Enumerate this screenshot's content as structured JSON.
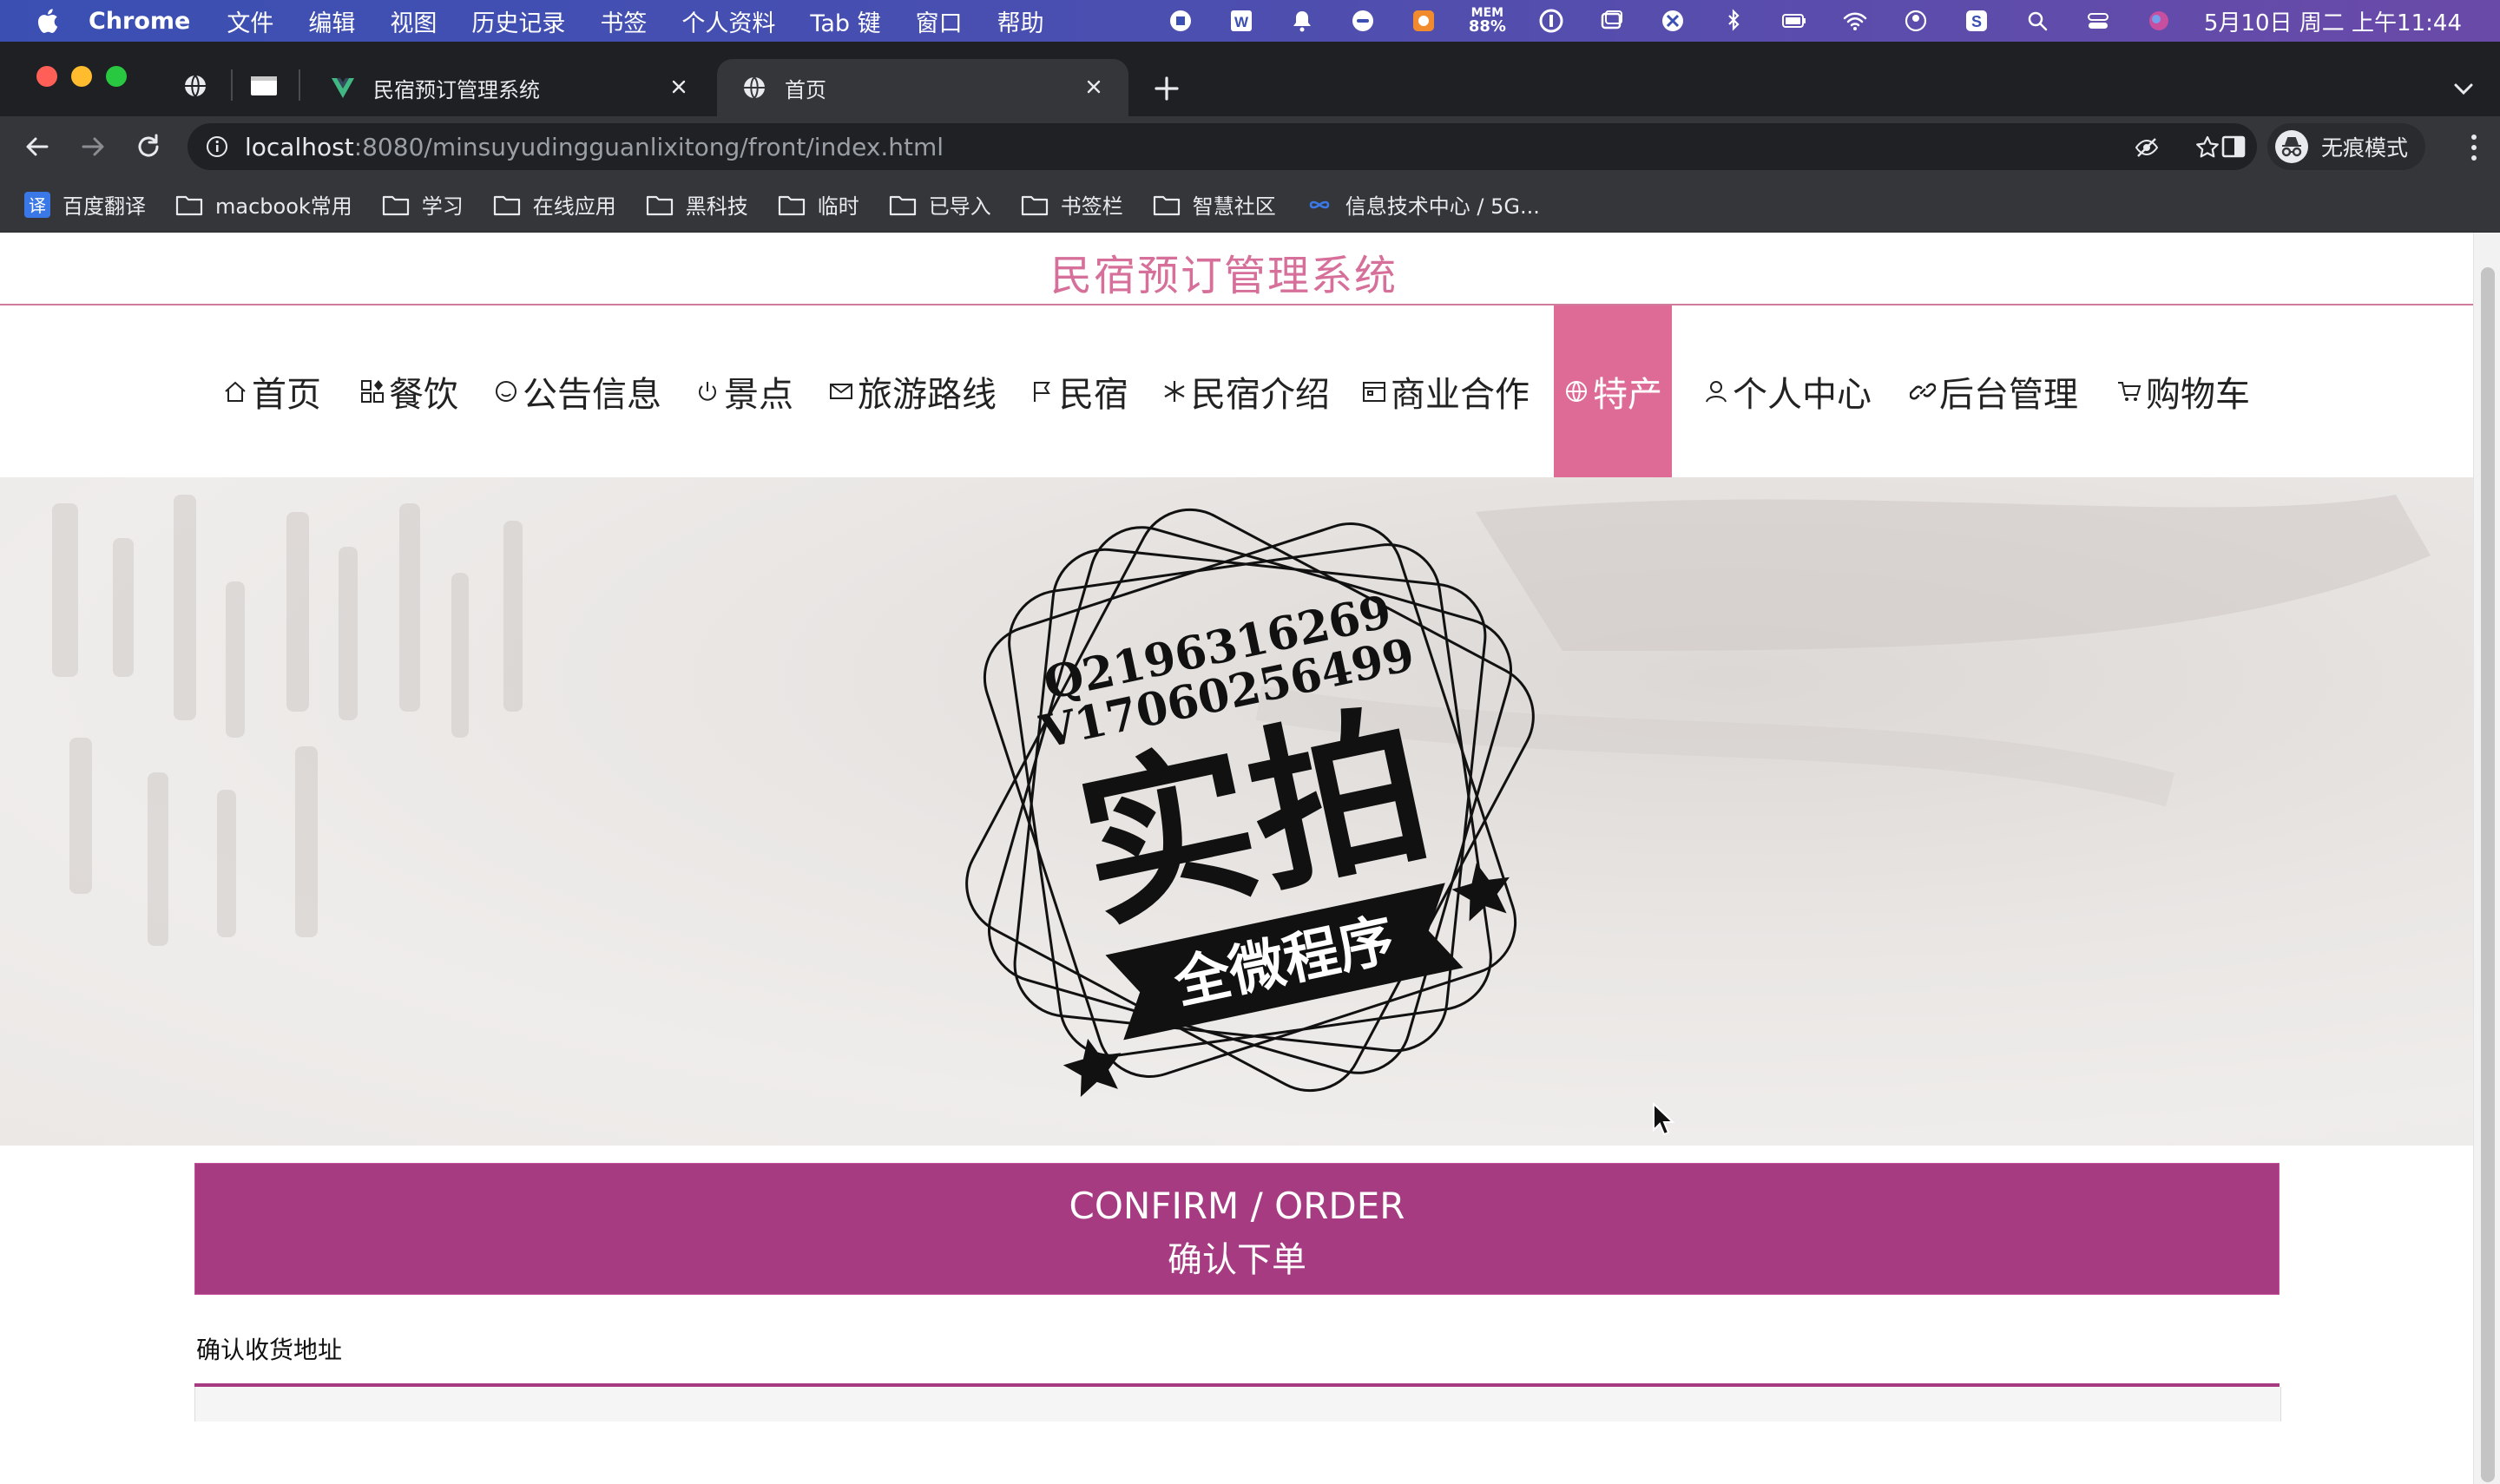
{
  "menubar": {
    "app": "Chrome",
    "items": [
      "文件",
      "编辑",
      "视图",
      "历史记录",
      "书签",
      "个人资料",
      "Tab 键",
      "窗口",
      "帮助"
    ],
    "mem_label": "MEM",
    "mem_value": "88%",
    "clock": "5月10日 周二 上午11:44"
  },
  "tabs": [
    {
      "title": "民宿预订管理系统",
      "active": false
    },
    {
      "title": "首页",
      "active": true
    }
  ],
  "address": {
    "host": "localhost",
    "path": ":8080/minsuyudingguanlixitong/front/index.html",
    "incognito_label": "无痕模式"
  },
  "bookmarks": [
    "百度翻译",
    "macbook常用",
    "学习",
    "在线应用",
    "黑科技",
    "临时",
    "已导入",
    "书签栏",
    "智慧社区",
    "信息技术中心 / 5G..."
  ],
  "bookmark_translate_glyph": "译",
  "site": {
    "title": "民宿预订管理系统",
    "nav": [
      {
        "label": "首页",
        "icon": "home-icon"
      },
      {
        "label": "餐饮",
        "icon": "grid-icon"
      },
      {
        "label": "公告信息",
        "icon": "smile-icon"
      },
      {
        "label": "景点",
        "icon": "power-icon"
      },
      {
        "label": "旅游路线",
        "icon": "mail-icon"
      },
      {
        "label": "民宿",
        "icon": "flag-icon"
      },
      {
        "label": "民宿介绍",
        "icon": "snowflake-icon"
      },
      {
        "label": "商业合作",
        "icon": "calendar-icon"
      },
      {
        "label": "特产",
        "icon": "globe-icon",
        "active": true
      },
      {
        "label": "个人中心",
        "icon": "user-icon"
      },
      {
        "label": "后台管理",
        "icon": "link-icon"
      },
      {
        "label": "购物车",
        "icon": "cart-icon"
      }
    ],
    "accent": "#dd6b95",
    "primary": "#a63b82"
  },
  "stamp": {
    "line1": "Q2196316269",
    "line2": "V17060256499",
    "big": "实拍",
    "ribbon": "全微程序"
  },
  "confirm": {
    "en": "CONFIRM / ORDER",
    "zh": "确认下单"
  },
  "address_section": {
    "label": "确认收货地址"
  }
}
